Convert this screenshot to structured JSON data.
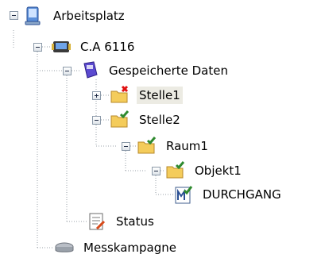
{
  "tree": {
    "nodes": [
      {
        "label": "Arbeitsplatz",
        "icon": "computer-icon",
        "state": "expanded"
      },
      {
        "label": "C.A 6116",
        "icon": "device-icon",
        "state": "expanded"
      },
      {
        "label": "Gespeicherte Daten",
        "icon": "saved-data-icon",
        "state": "expanded"
      },
      {
        "label": "Stelle1",
        "icon": "folder-error-icon",
        "state": "collapsed",
        "selected": true
      },
      {
        "label": "Stelle2",
        "icon": "folder-check-icon",
        "state": "expanded"
      },
      {
        "label": "Raum1",
        "icon": "folder-check-icon",
        "state": "expanded"
      },
      {
        "label": "Objekt1",
        "icon": "folder-check-icon",
        "state": "expanded"
      },
      {
        "label": "DURCHGANG",
        "icon": "measurement-check-icon",
        "state": "leaf"
      },
      {
        "label": "Status",
        "icon": "status-icon",
        "state": "leaf"
      },
      {
        "label": "Messkampagne",
        "icon": "drive-icon",
        "state": "leaf"
      }
    ]
  },
  "colors": {
    "connector": "#9aa0a8",
    "toggle_border": "#8c9aa9",
    "selection_bg": "#ecebe3",
    "folder": "#f4cc5b",
    "error_mark": "#e01010",
    "check_mark": "#2f8a2f"
  }
}
